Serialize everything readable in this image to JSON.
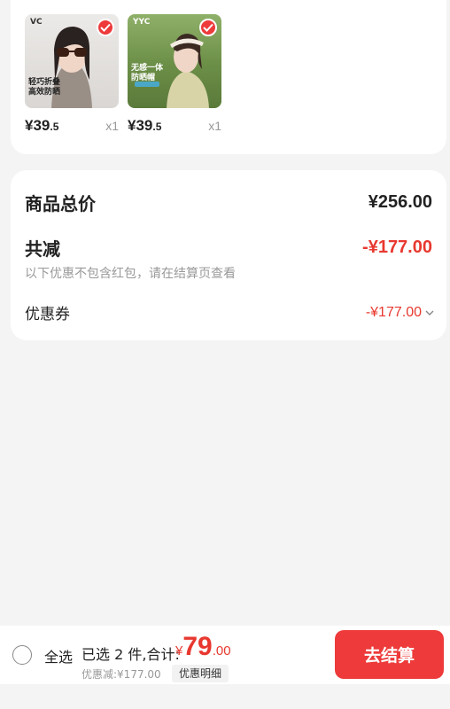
{
  "products": [
    {
      "brand": "VC",
      "caption": "轻巧折叠\n高效防晒",
      "price_int": "¥39",
      "price_dec": ".5",
      "qty": "x1",
      "selected": true
    },
    {
      "brand": "YYC",
      "caption": "无感一体\n防晒帽",
      "price_int": "¥39",
      "price_dec": ".5",
      "qty": "x1",
      "selected": true
    }
  ],
  "summary": {
    "total_label": "商品总价",
    "total_value": "¥256.00",
    "reduce_label": "共减",
    "reduce_value": "-¥177.00",
    "note": "以下优惠不包含红包，请在结算页查看",
    "coupon_label": "优惠券",
    "coupon_value": "-¥177.00"
  },
  "bottom_bar": {
    "select_all": "全选",
    "selected_text": "已选 2 件,合计:",
    "total_yen": "¥",
    "total_int": "79",
    "total_dec": ".00",
    "discount_line": "优惠减:¥177.00",
    "detail_button": "优惠明细",
    "checkout_button": "去结算"
  },
  "colors": {
    "accent": "#ee3a3a",
    "price_red": "#e8382f",
    "background": "#f4f4f4"
  }
}
